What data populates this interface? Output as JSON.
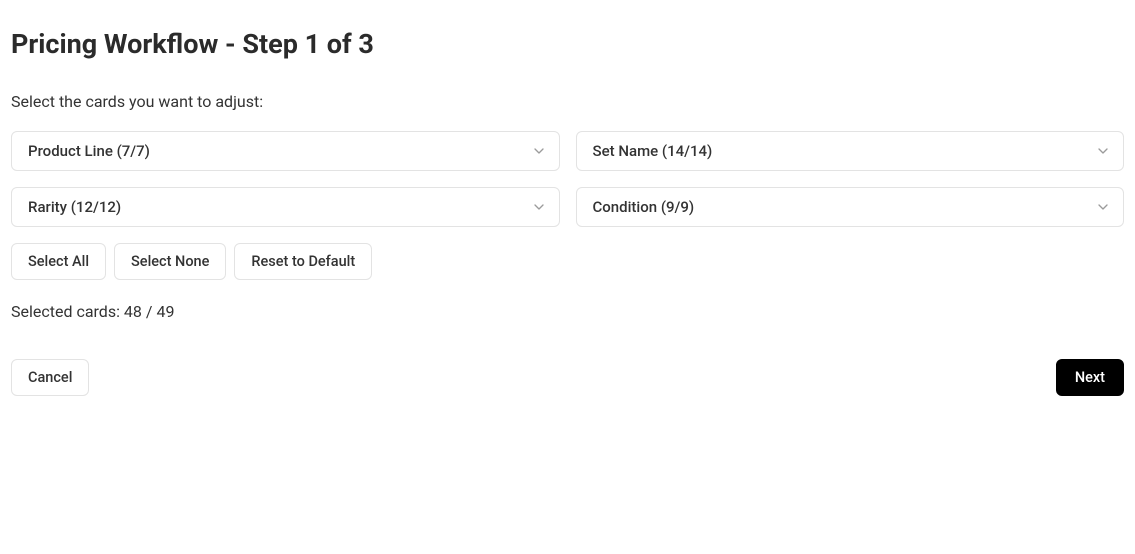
{
  "header": {
    "title": "Pricing Workflow - Step 1 of 3"
  },
  "instruction": "Select the cards you want to adjust:",
  "dropdowns": {
    "product_line": {
      "label": "Product Line (7/7)"
    },
    "set_name": {
      "label": "Set Name (14/14)"
    },
    "rarity": {
      "label": "Rarity (12/12)"
    },
    "condition": {
      "label": "Condition (9/9)"
    }
  },
  "actions": {
    "select_all": "Select All",
    "select_none": "Select None",
    "reset_default": "Reset to Default"
  },
  "selected_cards": "Selected cards: 48 / 49",
  "footer": {
    "cancel": "Cancel",
    "next": "Next"
  }
}
